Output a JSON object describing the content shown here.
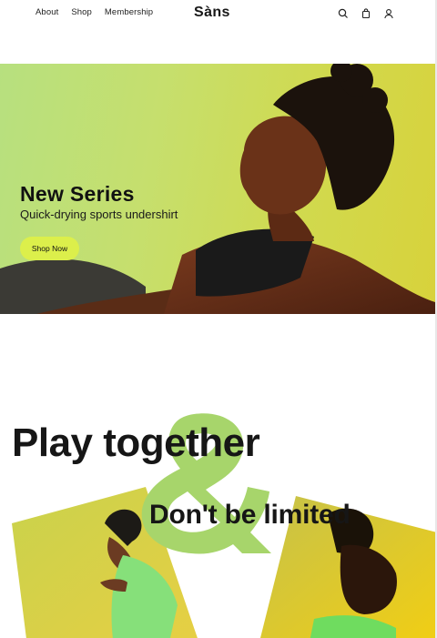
{
  "nav": {
    "about": "About",
    "shop": "Shop",
    "membership": "Membership"
  },
  "brand": {
    "logo": "Sàns"
  },
  "header_icons": [
    "search-icon",
    "bag-icon",
    "user-icon"
  ],
  "hero": {
    "title": "New Series",
    "subtitle": "Quick-drying sports undershirt",
    "cta": "Shop Now"
  },
  "promo": {
    "title": "Play together",
    "subtitle": "Don't be limited"
  },
  "colors": {
    "accent": "#dcef4b",
    "hero_bg": "#c6df6d",
    "text": "#161616",
    "ampersand": "#a7d56b"
  }
}
